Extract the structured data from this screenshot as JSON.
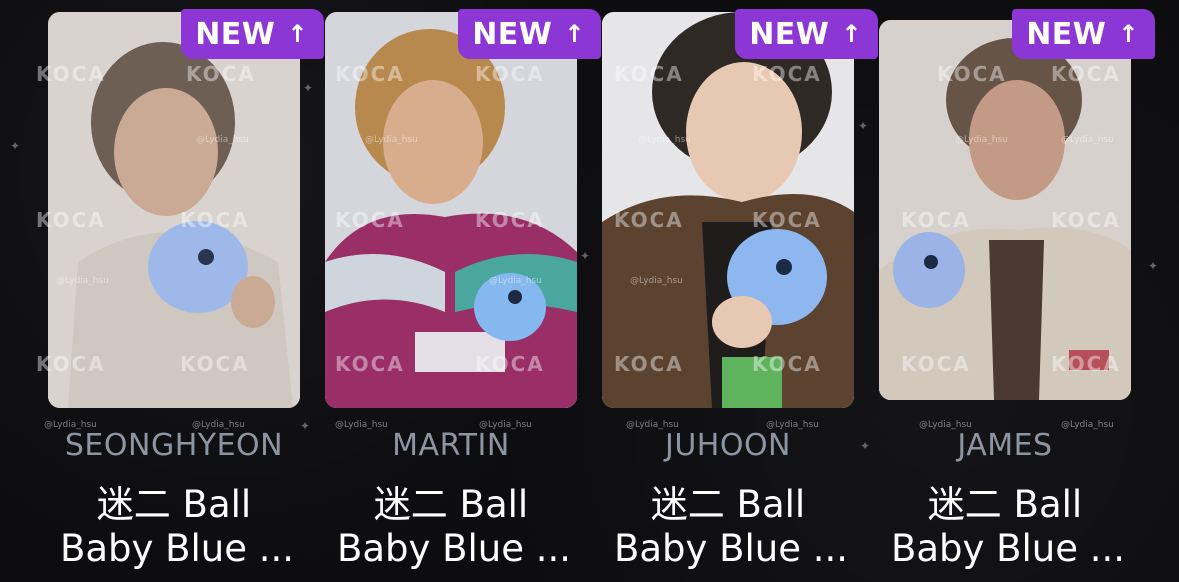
{
  "cards": [
    {
      "badge": "NEW",
      "member": "SEONGHYEON",
      "line1": "迷二 Ball",
      "line2": "Baby Blue ...",
      "watermark": "KOCA",
      "handle": "@Lydia_hsu",
      "bg": "#d9d3cf",
      "shirt": "#cfc8c1",
      "hair": "#5a4a40",
      "plush": "#9fb8ea"
    },
    {
      "badge": "NEW",
      "member": "MARTIN",
      "line1": "迷二 Ball",
      "line2": "Baby Blue ...",
      "watermark": "KOCA",
      "handle": "@Lydia_hsu",
      "bg": "#d5d6db",
      "shirt": "#9a2f68",
      "hair": "#b8894e",
      "plush": "#84b8ef"
    },
    {
      "badge": "NEW",
      "member": "JUHOON",
      "line1": "迷二 Ball",
      "line2": "Baby Blue ...",
      "watermark": "KOCA",
      "handle": "@Lydia_hsu",
      "bg": "#e6e5e7",
      "shirt": "#5b4330",
      "hair": "#2f2926",
      "plush": "#8db7ee"
    },
    {
      "badge": "NEW",
      "member": "JAMES",
      "line1": "迷二 Ball",
      "line2": "Baby Blue ...",
      "watermark": "KOCA",
      "handle": "@Lydia_hsu",
      "bg": "#d6d1cd",
      "shirt": "#d2c9bc",
      "hair": "#5a4638",
      "plush": "#9bb3e6"
    }
  ],
  "colors": {
    "badge": "#8c36d6",
    "name": "#8d95a3",
    "background": "#0d0d10"
  },
  "icons": {
    "badge_arrow": "arrow-up-icon"
  }
}
